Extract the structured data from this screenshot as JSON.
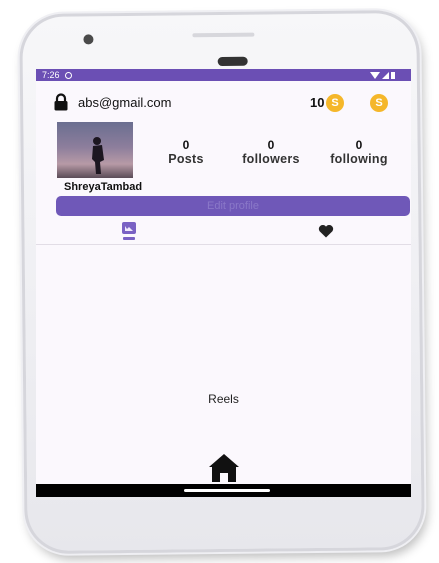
{
  "status_bar": {
    "time": "7:26",
    "color": "#6b4fb4"
  },
  "header": {
    "email": "abs@gmail.com",
    "coin_count": "10",
    "coin_symbol": "S",
    "coin_color": "#f5b72a"
  },
  "profile": {
    "username": "ShreyaTambad",
    "stats": [
      {
        "value": "0",
        "label": "Posts"
      },
      {
        "value": "0",
        "label": "followers"
      },
      {
        "value": "0",
        "label": "following"
      }
    ],
    "edit_button_label": "Edit profile",
    "accent_color": "#6f58b8"
  },
  "tabs": [
    {
      "icon": "grid-icon"
    },
    {
      "icon": "heart-icon"
    }
  ],
  "content": {
    "placeholder": "Reels"
  },
  "bottom_nav": {
    "icon": "home-icon"
  }
}
